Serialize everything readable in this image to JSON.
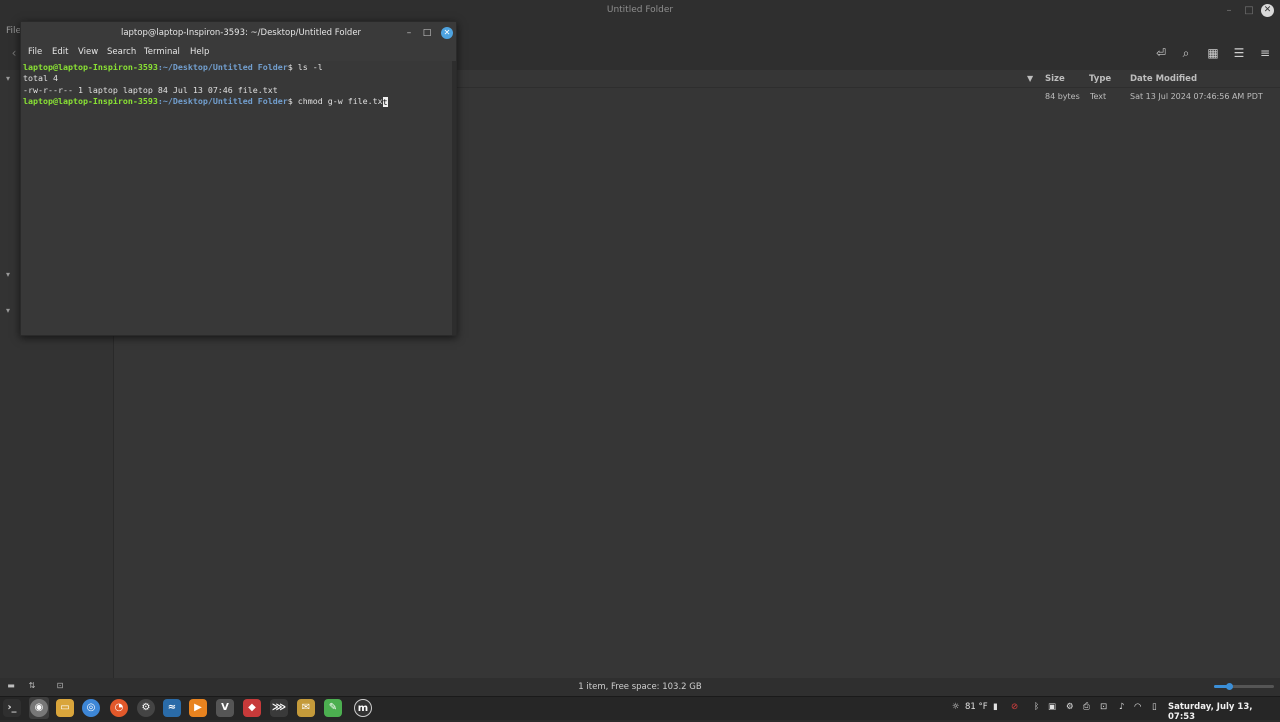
{
  "file_manager": {
    "title": "Untitled Folder",
    "menu_file": "File",
    "columns": {
      "size": "Size",
      "type": "Type",
      "date_modified": "Date Modified"
    },
    "rows": [
      {
        "size": "84 bytes",
        "type": "Text",
        "date_modified": "Sat 13 Jul 2024 07:46:56 AM PDT"
      }
    ],
    "status": "1 item, Free space: 103.2 GB",
    "zoom_level": 0.25
  },
  "terminal": {
    "title": "laptop@laptop-Inspiron-3593: ~/Desktop/Untitled Folder",
    "menu": [
      "File",
      "Edit",
      "View",
      "Search",
      "Terminal",
      "Help"
    ],
    "prompt_user": "laptop@laptop-Inspiron-3593",
    "prompt_path": ":~/Desktop/Untitled Folder",
    "prompt_symbol": "$",
    "lines": {
      "cmd1": " ls -l",
      "out1": "total 4",
      "out2": "-rw-r--r-- 1 laptop laptop 84 Jul 13 07:46 file.txt",
      "cmd2": " chmod g-w file.tx",
      "cursor_char": "t"
    }
  },
  "taskbar": {
    "weather": "81 °F",
    "clock": "Saturday, July 13, 07:53"
  }
}
